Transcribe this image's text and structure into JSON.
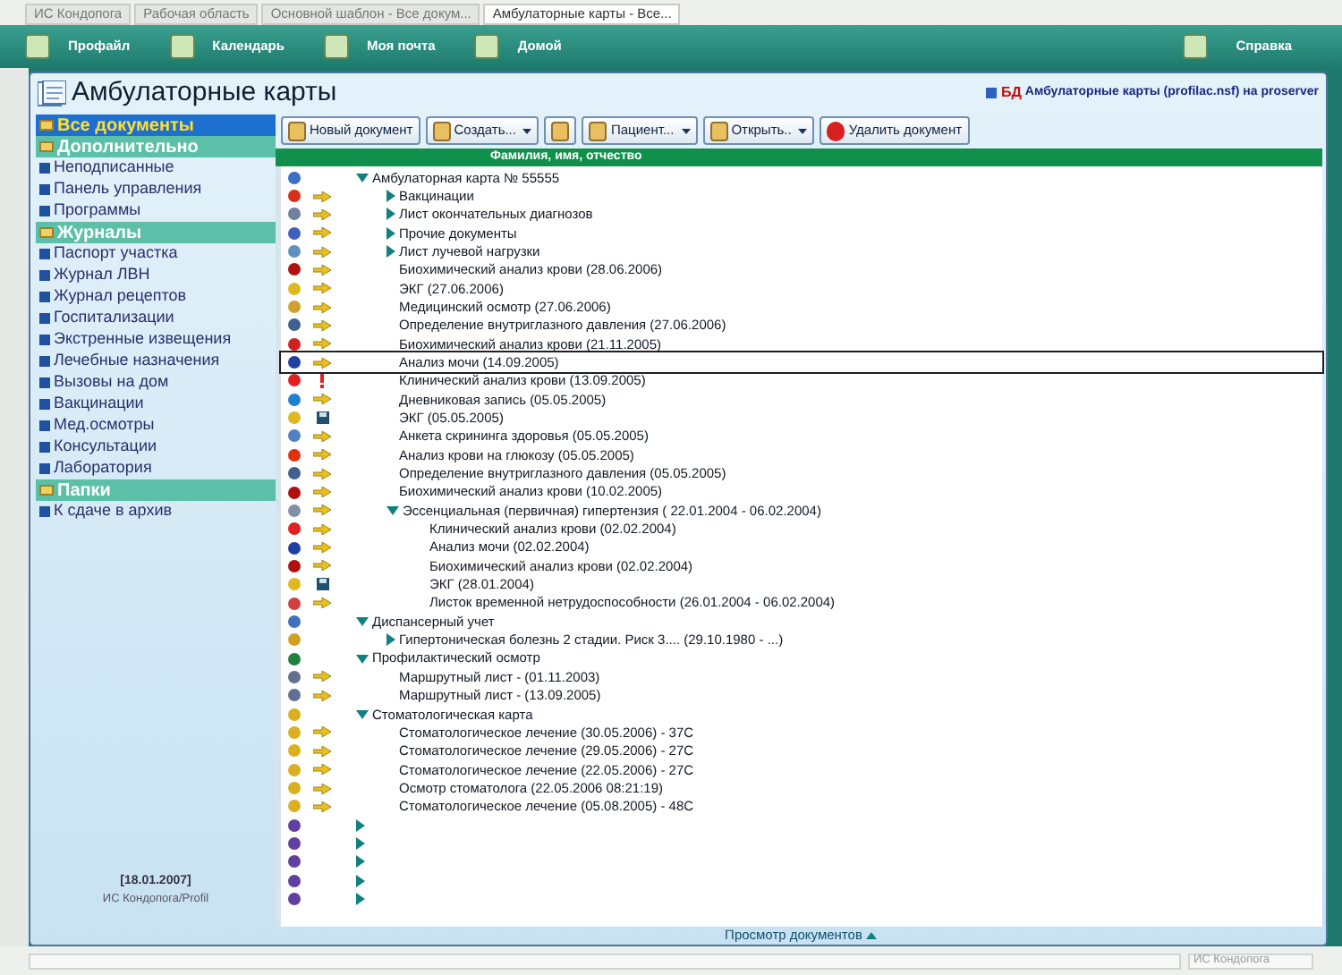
{
  "tabs": [
    {
      "label": "ИС Кондопога",
      "selected": false
    },
    {
      "label": "Рабочая область",
      "selected": false
    },
    {
      "label": "Основной шаблон - Все докум...",
      "selected": false
    },
    {
      "label": "Амбулаторные карты - Все...",
      "selected": true
    }
  ],
  "toolbar": [
    {
      "label": "Профайл",
      "kind": "left"
    },
    {
      "label": "Календарь",
      "kind": "left"
    },
    {
      "label": "Моя почта",
      "kind": "left"
    },
    {
      "label": "Домой",
      "kind": "left"
    },
    {
      "label": "Справка",
      "kind": "right"
    }
  ],
  "window": {
    "title": "Амбулаторные карты",
    "db_tag": "БД",
    "db_label": "Амбулаторные карты (profilac.nsf) на proserver"
  },
  "sidebar": {
    "items": [
      {
        "label": "Все документы",
        "kind": "section",
        "selected": true
      },
      {
        "label": "Дополнительно",
        "kind": "section",
        "selected": false
      },
      {
        "label": "Неподписанные",
        "kind": "link",
        "selected": false
      },
      {
        "label": "Панель управления",
        "kind": "link",
        "selected": false
      },
      {
        "label": "Программы",
        "kind": "link",
        "selected": false
      },
      {
        "label": "Журналы",
        "kind": "section",
        "selected": false
      },
      {
        "label": "Паспорт участка",
        "kind": "link",
        "selected": false
      },
      {
        "label": "Журнал ЛВН",
        "kind": "link",
        "selected": false
      },
      {
        "label": "Журнал рецептов",
        "kind": "link",
        "selected": false
      },
      {
        "label": "Госпитализации",
        "kind": "link",
        "selected": false
      },
      {
        "label": "Экстренные извещения",
        "kind": "link",
        "selected": false
      },
      {
        "label": "Лечебные назначения",
        "kind": "link",
        "selected": false
      },
      {
        "label": "Вызовы на дом",
        "kind": "link",
        "selected": false
      },
      {
        "label": "Вакцинации",
        "kind": "link",
        "selected": false
      },
      {
        "label": "Мед.осмотры",
        "kind": "link",
        "selected": false
      },
      {
        "label": "Консультации",
        "kind": "link",
        "selected": false
      },
      {
        "label": "Лаборатория",
        "kind": "link",
        "selected": false
      },
      {
        "label": "Папки",
        "kind": "section",
        "selected": false
      },
      {
        "label": "К сдаче в архив",
        "kind": "link",
        "selected": false
      }
    ],
    "date": "[18.01.2007]",
    "footer": "ИС Кондопога/Profil"
  },
  "actions": [
    {
      "label": "Новый документ",
      "menu": false
    },
    {
      "label": "Создать...",
      "menu": true
    },
    {
      "menu": false
    },
    {
      "label": "Пациент...",
      "menu": true
    },
    {
      "label": "Открыть..",
      "menu": true
    },
    {
      "label": "Удалить документ",
      "menu": false
    }
  ],
  "table": {
    "column": "Фамилия, имя, отчество",
    "rows": [
      {
        "label": "Амбулаторная карта № 55555",
        "expanded": true,
        "color": "#3a6fc4",
        "selected": false,
        "children": [
          {
            "label": "Вакцинации",
            "expanded": false,
            "color": "#d83018",
            "kind": "arrow",
            "selected": false
          },
          {
            "label": "Лист окончательных диагнозов",
            "expanded": false,
            "color": "#7080a0",
            "kind": "arrow",
            "selected": false
          },
          {
            "label": "Прочие документы",
            "expanded": false,
            "color": "#4060c0",
            "kind": "arrow",
            "selected": false
          },
          {
            "label": "Лист лучевой нагрузки",
            "expanded": false,
            "color": "#6090c0",
            "kind": "arrow",
            "selected": false
          },
          {
            "label": "Биохимический анализ крови  (28.06.2006)",
            "color": "#b01010",
            "kind": "arrow",
            "selected": false
          },
          {
            "label": "ЭКГ (27.06.2006)",
            "color": "#e0b820",
            "kind": "arrow",
            "selected": false
          },
          {
            "label": "Медицинский осмотр  (27.06.2006)",
            "color": "#d0a030",
            "kind": "arrow",
            "selected": false
          },
          {
            "label": "Определение внутриглазного давления  (27.06.2006)",
            "color": "#406090",
            "kind": "arrow",
            "selected": false
          },
          {
            "label": "Биохимический анализ крови  (21.11.2005)",
            "color": "#d02020",
            "kind": "arrow",
            "selected": false
          },
          {
            "label": "Анализ мочи  (14.09.2005)",
            "color": "#2040a0",
            "kind": "arrow",
            "selected": true
          },
          {
            "label": "Клинический анализ крови  (13.09.2005)",
            "color": "#e02020",
            "kind": "alert",
            "selected": false
          },
          {
            "label": "Дневниковая запись (05.05.2005)",
            "color": "#2080d0",
            "kind": "arrow",
            "selected": false
          },
          {
            "label": "ЭКГ (05.05.2005)",
            "color": "#e0b820",
            "kind": "disk",
            "selected": false
          },
          {
            "label": "Анкета скрининга здоровья  (05.05.2005)",
            "color": "#5080c0",
            "kind": "arrow",
            "selected": false
          },
          {
            "label": "Анализ крови на глюкозу  (05.05.2005)",
            "color": "#e03010",
            "kind": "arrow",
            "selected": false
          },
          {
            "label": "Определение внутриглазного давления  (05.05.2005)",
            "color": "#406090",
            "kind": "arrow",
            "selected": false
          },
          {
            "label": "Биохимический анализ крови  (10.02.2005)",
            "color": "#b01010",
            "kind": "arrow",
            "selected": false
          },
          {
            "label": "Эссенциальная (первичная) гипертензия ( 22.01.2004 - 06.02.2004)",
            "expanded": true,
            "color": "#8090a8",
            "kind": "arrow",
            "selected": false,
            "children": [
              {
                "label": "Клинический анализ крови  (02.02.2004)",
                "color": "#e02020",
                "kind": "arrow",
                "selected": false
              },
              {
                "label": "Анализ мочи  (02.02.2004)",
                "color": "#2040a0",
                "kind": "arrow",
                "selected": false
              },
              {
                "label": "Биохимический анализ крови  (02.02.2004)",
                "color": "#b01010",
                "kind": "arrow",
                "selected": false
              },
              {
                "label": "ЭКГ (28.01.2004)",
                "color": "#e0b820",
                "kind": "disk",
                "selected": false
              },
              {
                "label": "Листок временной нетрудоспособности  (26.01.2004 - 06.02.2004)",
                "color": "#d04040",
                "kind": "arrow",
                "selected": false
              }
            ]
          }
        ]
      },
      {
        "label": "Диспансерный учет",
        "expanded": true,
        "color": "#4070c0",
        "selected": false,
        "children": [
          {
            "label": "Гипертоническая болезнь 2  стадии. Риск 3.... (29.10.1980 - ...)",
            "expanded": false,
            "color": "#d0a020",
            "selected": false
          }
        ]
      },
      {
        "label": "Профилактический осмотр",
        "expanded": true,
        "color": "#208040",
        "selected": false,
        "children": [
          {
            "label": "Маршрутный лист -  (01.11.2003)",
            "color": "#607090",
            "kind": "arrow",
            "selected": false
          },
          {
            "label": "Маршрутный лист -  (13.09.2005)",
            "color": "#607090",
            "kind": "arrow",
            "selected": false
          }
        ]
      },
      {
        "label": "Стоматологическая карта",
        "expanded": true,
        "color": "#d8b020",
        "selected": false,
        "children": [
          {
            "label": "Стоматологическое лечение  (30.05.2006) - 37С",
            "color": "#d8b020",
            "kind": "arrow",
            "selected": false
          },
          {
            "label": "Стоматологическое лечение  (29.05.2006) - 27С",
            "color": "#d8b020",
            "kind": "arrow",
            "selected": false
          },
          {
            "label": "Стоматологическое лечение  (22.05.2006) - 27С",
            "color": "#d8b020",
            "kind": "arrow",
            "selected": false
          },
          {
            "label": "Осмотр стоматолога  (22.05.2006 08:21:19)",
            "color": "#d8b020",
            "kind": "arrow",
            "selected": false
          },
          {
            "label": "Стоматологическое лечение  (05.08.2005) - 48С",
            "color": "#d8b020",
            "kind": "arrow",
            "selected": false
          }
        ]
      },
      {
        "expanded": false,
        "color": "#6040a0",
        "selected": false
      },
      {
        "expanded": false,
        "color": "#6040a0",
        "selected": false
      },
      {
        "expanded": false,
        "color": "#6040a0",
        "selected": false
      },
      {
        "expanded": false,
        "color": "#6040a0",
        "selected": false
      },
      {
        "expanded": false,
        "color": "#6040a0",
        "selected": false
      }
    ]
  },
  "pager": "Просмотр документов",
  "status_bar": {
    "location": "ИС Кондопога"
  }
}
